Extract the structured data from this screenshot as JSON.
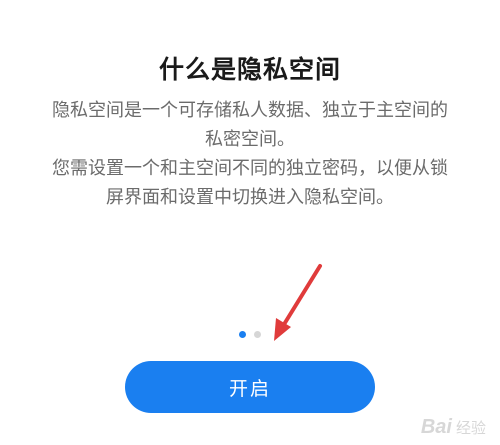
{
  "intro": {
    "title": "什么是隐私空间",
    "description_lines_1": [
      "隐私空间是一个可存储私人数据、独立于主空间的",
      "私密空间。"
    ],
    "description_lines_2": [
      "您需设置一个和主空间不同的独立密码，以便从锁",
      "屏界面和设置中切换进入隐私空间。"
    ]
  },
  "pager": {
    "total": 2,
    "active_index": 0
  },
  "actions": {
    "open_label": "开启"
  },
  "annotation": {
    "arrow_color": "#e03b3b"
  },
  "watermark": {
    "brand": "Bai",
    "sub": "经验"
  },
  "colors": {
    "accent": "#1a7ff0",
    "dot_inactive": "#d6d6d6"
  }
}
